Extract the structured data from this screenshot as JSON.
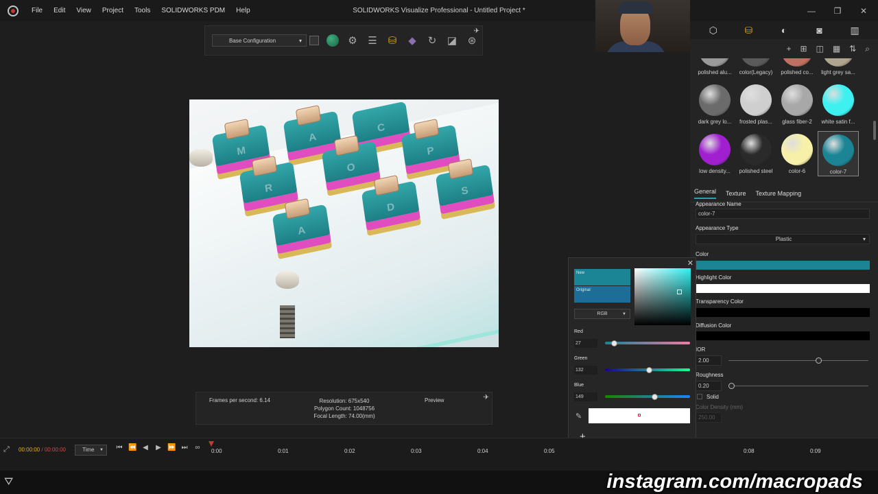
{
  "window": {
    "title": "SOLIDWORKS Visualize Professional - Untitled Project *"
  },
  "menu": [
    "File",
    "Edit",
    "View",
    "Project",
    "Tools",
    "SOLIDWORKS PDM",
    "Help"
  ],
  "toolbar": {
    "config": "Base Configuration"
  },
  "stats": {
    "fps": "Frames per second: 6.14",
    "resolution": "Resolution: 675x540",
    "polygons": "Polygon Count: 1048756",
    "focal": "Focal Length: 74.00(mm)",
    "mode": "Preview"
  },
  "render": {
    "legends": [
      "M",
      "A",
      "C",
      "P",
      "R",
      "O",
      "S",
      "D",
      "A"
    ]
  },
  "materials": [
    {
      "name": "polished alu...",
      "color": "#9a9a9a"
    },
    {
      "name": "color(Legacy)",
      "color": "#5a5a5a"
    },
    {
      "name": "polished co...",
      "color": "#c07060"
    },
    {
      "name": "light grey sa...",
      "color": "#b0a58e"
    },
    {
      "name": "dark grey lo...",
      "color": "#6b6b6b"
    },
    {
      "name": "frosted plas...",
      "color": "#cfcfcf"
    },
    {
      "name": "glass fiber-2",
      "color": "#a8a8a8"
    },
    {
      "name": "white satin f...",
      "color": "#3ff0f0"
    },
    {
      "name": "low density...",
      "color": "#a020d0"
    },
    {
      "name": "polished steel",
      "color": "#2a2a2a"
    },
    {
      "name": "color-6",
      "color": "#f6f0a8"
    },
    {
      "name": "color-7",
      "color": "#1b8495"
    }
  ],
  "appearance": {
    "tabs": [
      "General",
      "Texture",
      "Texture Mapping"
    ],
    "name_label": "Appearance Name",
    "name": "color-7",
    "type_label": "Appearance Type",
    "type": "Plastic",
    "color_label": "Color",
    "color": "#1b8495",
    "highlight_label": "Highlight Color",
    "highlight": "#ffffff",
    "transparency_label": "Transparency Color",
    "transparency": "#000000",
    "diffusion_label": "Diffusion Color",
    "diffusion": "#000000",
    "ior_label": "IOR",
    "ior": "2.00",
    "ior_level": 0.64,
    "roughness_label": "Roughness",
    "roughness": "0.20",
    "roughness_level": 0.02,
    "solid_label": "Solid",
    "density_label": "Color Density (mm)",
    "density": "250.00"
  },
  "picker": {
    "new_label": "New",
    "original_label": "Original",
    "mode": "RGB",
    "red_label": "Red",
    "red": "27",
    "green_label": "Green",
    "green": "132",
    "blue_label": "Blue",
    "blue": "149"
  },
  "timeline": {
    "current": "00:00:00",
    "end": "00:00:00",
    "mode": "Time",
    "ticks": [
      "0:00",
      "0:01",
      "0:02",
      "0:03",
      "0:04",
      "0:05",
      "0:08",
      "0:09"
    ]
  },
  "watermark": "instagram.com/macropads"
}
